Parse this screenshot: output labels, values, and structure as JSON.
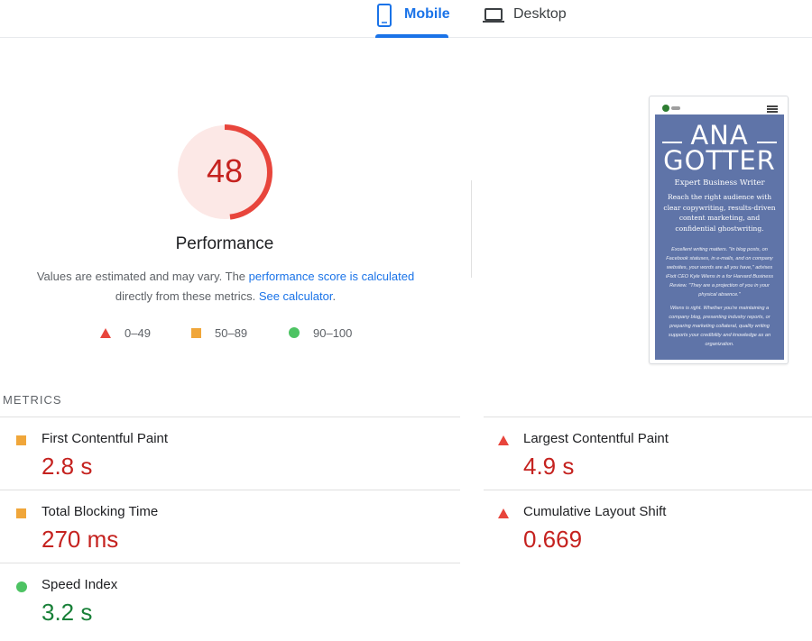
{
  "tabs": {
    "mobile": {
      "label": "Mobile",
      "icon": "phone-icon",
      "active": true
    },
    "desktop": {
      "label": "Desktop",
      "icon": "laptop-icon",
      "active": false
    }
  },
  "performance": {
    "score": "48",
    "score_value": 48,
    "title": "Performance",
    "description_prefix": "Values are estimated and may vary. The ",
    "description_link": "performance score is calculated",
    "description_middle": "directly from these metrics. ",
    "calculator_link": "See calculator",
    "description_suffix": "."
  },
  "legend": [
    {
      "shape": "triangle",
      "range": "0–49",
      "color": "#e8453c"
    },
    {
      "shape": "square",
      "range": "50–89",
      "color": "#f0a63a"
    },
    {
      "shape": "circle",
      "range": "90–100",
      "color": "#4dc363"
    }
  ],
  "screenshot": {
    "name_line1": "ANA",
    "name_line2": "GOTTER",
    "subtitle": "Expert Business Writer",
    "tagline": "Reach the right audience with clear copywriting, results-driven content marketing, and confidential ghostwriting.",
    "quote": "Excellent writing matters. \"In blog posts, on Facebook statuses, in e-mails, and on company websites, your words are all you have,\" advises iFixit CEO Kyle Wiens in a for Harvard Business Review. \"They are a projection of you in your physical absence.\"",
    "paragraph": "Wiens is right. Whether you're maintaining a company blog, presenting industry reports, or preparing marketing collateral, quality writing supports your credibility and knowledge as an organization."
  },
  "metrics": {
    "heading": "METRICS",
    "items": [
      {
        "label": "First Contentful Paint",
        "value": "2.8 s",
        "status": "average"
      },
      {
        "label": "Largest Contentful Paint",
        "value": "4.9 s",
        "status": "fail"
      },
      {
        "label": "Total Blocking Time",
        "value": "270 ms",
        "status": "average"
      },
      {
        "label": "Cumulative Layout Shift",
        "value": "0.669",
        "status": "fail"
      },
      {
        "label": "Speed Index",
        "value": "3.2 s",
        "status": "pass"
      }
    ]
  },
  "colors": {
    "accent": "#1a73e8",
    "fail": "#c5221f",
    "pass": "#188038",
    "average": "#f0a63a"
  }
}
